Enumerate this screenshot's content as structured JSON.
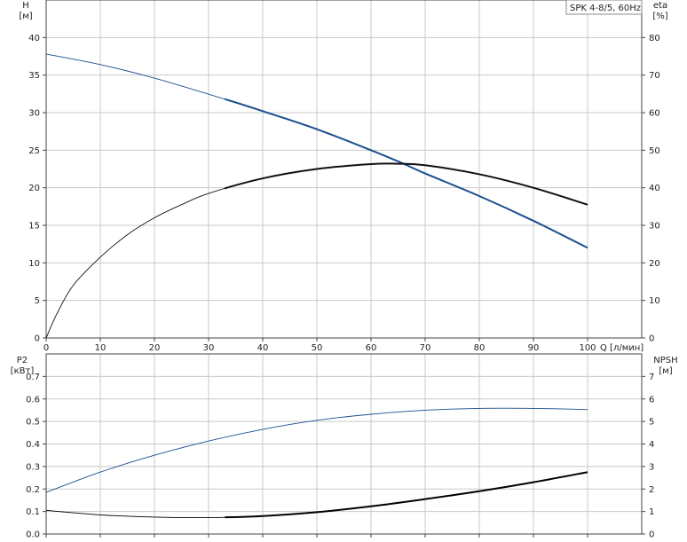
{
  "chart_data": [
    {
      "type": "line",
      "title": "SPK 4-8/5, 60Hz",
      "xlabel": "Q [л/мин]",
      "ylabel": "H",
      "ylabel_unit": "[м]",
      "y2label": "eta",
      "y2label_unit": "[%]",
      "xlim": [
        0,
        100
      ],
      "ylim": [
        0,
        45
      ],
      "y2lim": [
        0,
        90
      ],
      "x_ticks": [
        0,
        10,
        20,
        30,
        40,
        50,
        60,
        70,
        80,
        90,
        100
      ],
      "y_ticks": [
        0,
        5,
        10,
        15,
        20,
        25,
        30,
        35,
        40
      ],
      "y2_ticks": [
        0,
        10,
        20,
        30,
        40,
        50,
        60,
        70,
        80
      ],
      "grid": true,
      "series": [
        {
          "axis": "left",
          "color": "#1a4f8f",
          "x": [
            0,
            10,
            20,
            33,
            40,
            50,
            60,
            66,
            70,
            80,
            90,
            100
          ],
          "y": [
            37.8,
            36.4,
            34.6,
            31.8,
            30.2,
            27.8,
            25.0,
            23.2,
            21.9,
            18.9,
            15.6,
            12.0
          ],
          "bold_from": 33
        },
        {
          "axis": "right",
          "color": "#111111",
          "x": [
            0,
            2,
            5,
            10,
            15,
            20,
            25,
            30,
            40,
            50,
            60,
            65,
            70,
            80,
            90,
            100
          ],
          "y": [
            0,
            6.5,
            14,
            21.5,
            27.5,
            32,
            35.5,
            38.5,
            42.5,
            45,
            46.3,
            46.4,
            46,
            43.6,
            40,
            35.5
          ],
          "bold_from": 33
        }
      ]
    },
    {
      "type": "line",
      "ylabel": "P2",
      "ylabel_unit": "[кВт]",
      "y2label": "NPSH",
      "y2label_unit": "[м]",
      "xlim": [
        0,
        100
      ],
      "ylim": [
        0,
        0.8
      ],
      "y2lim": [
        0,
        8
      ],
      "x_ticks": [
        0,
        10,
        20,
        30,
        40,
        50,
        60,
        70,
        80,
        90,
        100
      ],
      "y_ticks": [
        "0.0",
        "0.1",
        "0.2",
        "0.3",
        "0.4",
        "0.5",
        "0.6",
        "0.7"
      ],
      "y2_ticks": [
        0,
        1,
        2,
        3,
        4,
        5,
        6,
        7
      ],
      "grid": true,
      "series": [
        {
          "axis": "left",
          "color": "#1a4f8f",
          "x": [
            0,
            10,
            20,
            30,
            40,
            50,
            60,
            70,
            80,
            90,
            100
          ],
          "y": [
            0.185,
            0.275,
            0.35,
            0.413,
            0.465,
            0.505,
            0.532,
            0.55,
            0.558,
            0.558,
            0.553
          ],
          "bold_from": null
        },
        {
          "axis": "right",
          "color": "#000000",
          "x": [
            0,
            10,
            20,
            30,
            40,
            50,
            60,
            70,
            80,
            90,
            100
          ],
          "y": [
            1.05,
            0.85,
            0.75,
            0.73,
            0.8,
            0.97,
            1.23,
            1.55,
            1.9,
            2.3,
            2.75
          ],
          "bold_from": 33
        }
      ]
    }
  ]
}
